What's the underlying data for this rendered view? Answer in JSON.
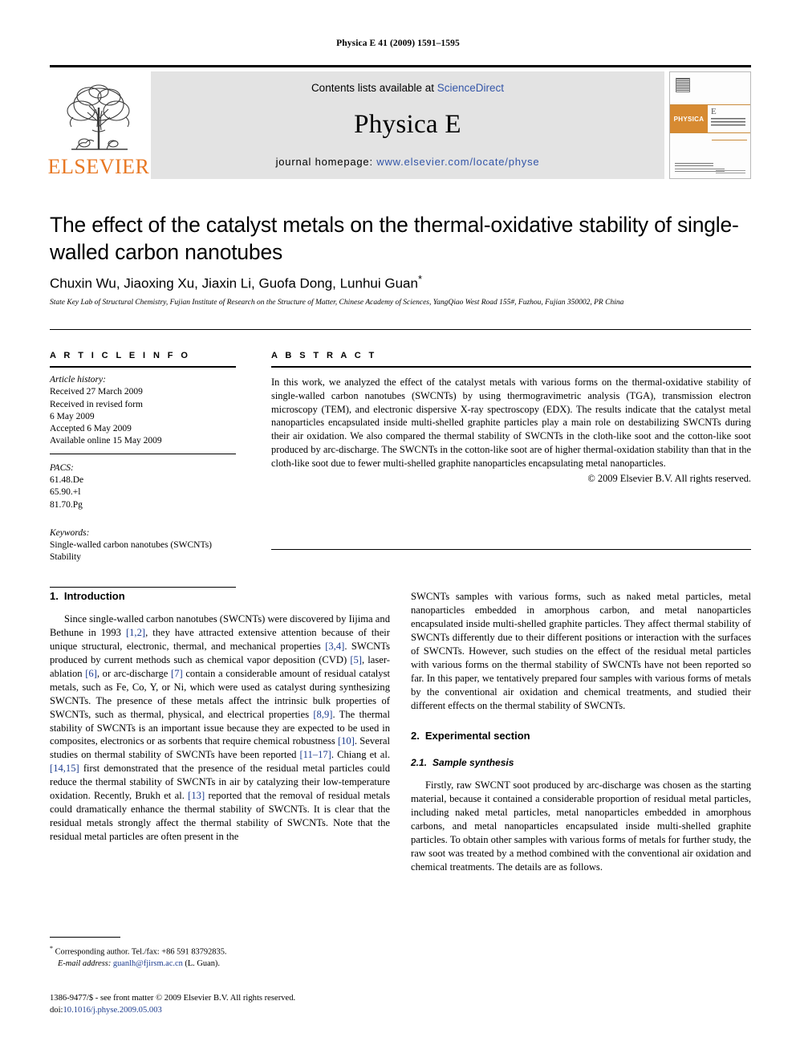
{
  "running_head": "Physica E 41 (2009) 1591–1595",
  "masthead": {
    "publisher_logo_text": "ELSEVIER",
    "contents_prefix": "Contents lists available at ",
    "contents_link": "ScienceDirect",
    "journal_name": "Physica E",
    "homepage_label": "journal homepage: ",
    "homepage_url": "www.elsevier.com/locate/physe",
    "cover": {
      "brand": "PHYSICA",
      "volume_letter": "E",
      "subtitle": "LOW-DIMENSIONAL SYSTEMS & NANOSTRUCTURES"
    },
    "accent_orange": "#E87722",
    "link_blue": "#3355a8"
  },
  "article": {
    "title": "The effect of the catalyst metals on the thermal-oxidative stability of single-walled carbon nanotubes",
    "authors": "Chuxin Wu, Jiaoxing Xu, Jiaxin Li, Guofa Dong, Lunhui Guan",
    "corresponding_marker": "*",
    "affiliation": "State Key Lab of Structural Chemistry, Fujian Institute of Research on the Structure of Matter, Chinese Academy of Sciences, YangQiao West Road 155#, Fuzhou, Fujian 350002, PR China"
  },
  "article_info": {
    "heading": "A R T I C L E   I N F O",
    "history_label": "Article history:",
    "history_lines": [
      "Received 27 March 2009",
      "Received in revised form",
      "6 May 2009",
      "Accepted 6 May 2009",
      "Available online 15 May 2009"
    ],
    "pacs_label": "PACS:",
    "pacs": [
      "61.48.De",
      "65.90.+l",
      "81.70.Pg"
    ],
    "keywords_label": "Keywords:",
    "keywords": [
      "Single-walled carbon nanotubes (SWCNTs)",
      "Stability"
    ]
  },
  "abstract": {
    "heading": "A B S T R A C T",
    "text": "In this work, we analyzed the effect of the catalyst metals with various forms on the thermal-oxidative stability of single-walled carbon nanotubes (SWCNTs) by using thermogravimetric analysis (TGA), transmission electron microscopy (TEM), and electronic dispersive X-ray spectroscopy (EDX). The results indicate that the catalyst metal nanoparticles encapsulated inside multi-shelled graphite particles play a main role on destabilizing SWCNTs during their air oxidation. We also compared the thermal stability of SWCNTs in the cloth-like soot and the cotton-like soot produced by arc-discharge. The SWCNTs in the cotton-like soot are of higher thermal-oxidation stability than that in the cloth-like soot due to fewer multi-shelled graphite nanoparticles encapsulating metal nanoparticles.",
    "copyright": "© 2009 Elsevier B.V. All rights reserved."
  },
  "body": {
    "intro_heading_num": "1.",
    "intro_heading": "Introduction",
    "intro_p1_a": "Since single-walled carbon nanotubes (SWCNTs) were discovered by Iijima and Bethune in 1993 ",
    "intro_ref_12": "[1,2]",
    "intro_p1_b": ", they have attracted extensive attention because of their unique structural, electronic, thermal, and mechanical properties ",
    "intro_ref_34": "[3,4]",
    "intro_p1_c": ". SWCNTs produced by current methods such as chemical vapor deposition (CVD) ",
    "intro_ref_5": "[5]",
    "intro_p1_d": ", laser-ablation ",
    "intro_ref_6": "[6]",
    "intro_p1_e": ", or arc-discharge ",
    "intro_ref_7": "[7]",
    "intro_p1_f": " contain a considerable amount of residual catalyst metals, such as Fe, Co, Y, or Ni, which were used as catalyst during synthesizing SWCNTs. The presence of these metals affect the intrinsic bulk properties of SWCNTs, such as thermal, physical, and electrical properties ",
    "intro_ref_89": "[8,9]",
    "intro_p1_g": ". The thermal stability of SWCNTs is an important issue because they are expected to be used in composites, electronics or as sorbents that require chemical robustness ",
    "intro_ref_10": "[10]",
    "intro_p1_h": ". Several studies on thermal stability of SWCNTs have been reported ",
    "intro_ref_1117": "[11–17]",
    "intro_p1_i": ". Chiang et al. ",
    "intro_ref_1415": "[14,15]",
    "intro_p1_j": " first demonstrated that the presence of the residual metal particles could reduce the thermal stability of SWCNTs in air by catalyzing their low-temperature oxidation. Recently, Brukh et al. ",
    "intro_ref_13": "[13]",
    "intro_p1_k": " reported that the removal of residual metals could dramatically enhance the thermal stability of SWCNTs. It is clear that the residual metals strongly affect the thermal stability of SWCNTs. Note that the residual metal particles are often present in the",
    "intro_p2": "SWCNTs samples with various forms, such as naked metal particles, metal nanoparticles embedded in amorphous carbon, and metal nanoparticles encapsulated inside multi-shelled graphite particles. They affect thermal stability of SWCNTs differently due to their different positions or interaction with the surfaces of SWCNTs. However, such studies on the effect of the residual metal particles with various forms on the thermal stability of SWCNTs have not been reported so far. In this paper, we tentatively prepared four samples with various forms of metals by the conventional air oxidation and chemical treatments, and studied their different effects on the thermal stability of SWCNTs.",
    "exp_heading_num": "2.",
    "exp_heading": "Experimental section",
    "sub_heading_num": "2.1.",
    "sub_heading": "Sample synthesis",
    "exp_p1": "Firstly, raw SWCNT soot produced by arc-discharge was chosen as the starting material, because it contained a considerable proportion of residual metal particles, including naked metal particles, metal nanoparticles embedded in amorphous carbons, and metal nanoparticles encapsulated inside multi-shelled graphite particles. To obtain other samples with various forms of metals for further study, the raw soot was treated by a method combined with the conventional air oxidation and chemical treatments. The details are as follows."
  },
  "footnotes": {
    "corresponding_marker": "*",
    "corresponding_text": " Corresponding author. Tel./fax: +86 591 83792835.",
    "email_label": "E-mail address:",
    "email": " guanlh@fjirsm.ac.cn",
    "email_owner": " (L. Guan).",
    "issn_line": "1386-9477/$ - see front matter © 2009 Elsevier B.V. All rights reserved.",
    "doi_label": "doi:",
    "doi_value": "10.1016/j.physe.2009.05.003"
  }
}
